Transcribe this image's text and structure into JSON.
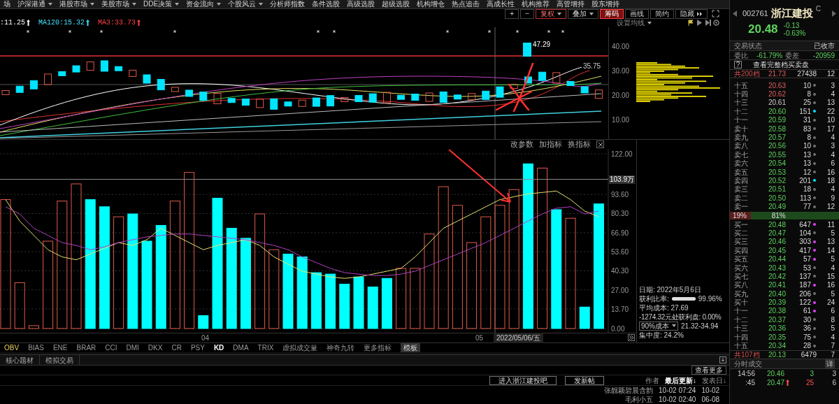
{
  "menu": [
    {
      "label": "场",
      "dropdown": false
    },
    {
      "label": "沪深港通",
      "dropdown": true
    },
    {
      "label": "港股市场",
      "dropdown": true
    },
    {
      "label": "美股市场",
      "dropdown": true
    },
    {
      "label": "DDE决策",
      "dropdown": true
    },
    {
      "label": "资金流向",
      "dropdown": true
    },
    {
      "label": "个股风云",
      "dropdown": true
    },
    {
      "label": "分析师指数",
      "dropdown": false
    },
    {
      "label": "条件选股",
      "dropdown": false
    },
    {
      "label": "高级选股",
      "dropdown": false
    },
    {
      "label": "超级选股",
      "dropdown": false
    },
    {
      "label": "机构增仓",
      "dropdown": false
    },
    {
      "label": "热点追击",
      "dropdown": false
    },
    {
      "label": "高成长性",
      "dropdown": false
    },
    {
      "label": "机构推荐",
      "dropdown": false
    },
    {
      "label": "高管增持",
      "dropdown": false
    },
    {
      "label": "股东增持",
      "dropdown": false
    }
  ],
  "toolbar": [
    {
      "label": "+",
      "kind": "icon",
      "selected": false
    },
    {
      "label": "−",
      "kind": "icon",
      "selected": false
    },
    {
      "label": "复权",
      "kind": "dropdown",
      "selected": false
    },
    {
      "label": "叠加",
      "kind": "dropdown",
      "selected": false
    },
    {
      "label": "筹码",
      "kind": "plain",
      "selected": true
    },
    {
      "label": "画线",
      "kind": "plain",
      "selected": false
    },
    {
      "label": "简约",
      "kind": "plain",
      "selected": false
    },
    {
      "label": "隐藏",
      "kind": "more",
      "selected": false
    }
  ],
  "legend": [
    {
      "label": ":11.25",
      "color": "#ffffff"
    },
    {
      "label": "MA120:15.32",
      "color": "#40e0ff"
    },
    {
      "label": "MA3:33.73",
      "color": "#ff4040"
    }
  ],
  "ma_settings": "设置均线",
  "price_chart": {
    "yticks": [
      "40.00",
      "30.00",
      "20.00",
      "10.00"
    ],
    "high_label": "47.29",
    "last_label": "35.75"
  },
  "volume_panel": {
    "actions": [
      "改参数",
      "加指标",
      "换指标"
    ],
    "cursor_value": "103.9万",
    "chart_data": {
      "type": "bar",
      "ylim": [
        0,
        122
      ],
      "grid": true,
      "yticks": [
        {
          "value": 0,
          "label": "0.00"
        },
        {
          "value": 13.7,
          "label": "13.70"
        },
        {
          "value": 27,
          "label": "27.00"
        },
        {
          "value": 40.3,
          "label": "40.30"
        },
        {
          "value": 53.6,
          "label": "53.60"
        },
        {
          "value": 66.9,
          "label": "66.90"
        },
        {
          "value": 80.3,
          "label": "80.30"
        },
        {
          "value": 93.6,
          "label": "93.60"
        },
        {
          "value": 122,
          "label": "122.00"
        }
      ],
      "series": [
        {
          "type": "bar",
          "color": "#e05a4a",
          "values": [
            90,
            32,
            2,
            61,
            89,
            101,
            null,
            null,
            78,
            null,
            null,
            null,
            89,
            109,
            null,
            null,
            null,
            null,
            80,
            55,
            null,
            null,
            null,
            null,
            null,
            null,
            null,
            null,
            42,
            42,
            66,
            99,
            86,
            60,
            78,
            86,
            97,
            null,
            112,
            null,
            77,
            null,
            null
          ]
        },
        {
          "type": "bar",
          "color": "#00ffff",
          "values": [
            null,
            null,
            null,
            null,
            null,
            null,
            90,
            85,
            null,
            80,
            61,
            72,
            null,
            null,
            9,
            91,
            70,
            63,
            null,
            null,
            52,
            50,
            39,
            38,
            31,
            36,
            29,
            35,
            null,
            null,
            null,
            null,
            null,
            null,
            null,
            null,
            null,
            115,
            null,
            83,
            null,
            15,
            87
          ]
        },
        {
          "type": "line",
          "color": "#e8e070",
          "values": [
            90,
            75,
            65,
            55,
            50,
            48,
            52,
            56,
            60,
            58,
            62,
            70,
            65,
            60,
            55,
            58,
            60,
            62,
            58,
            50,
            45,
            40,
            38,
            36,
            35,
            36,
            38,
            40,
            42,
            50,
            60,
            70,
            75,
            80,
            85,
            90,
            92,
            94,
            95,
            96,
            90,
            82,
            78
          ]
        },
        {
          "type": "line",
          "color": "#b040c0",
          "values": [
            85,
            80,
            70,
            65,
            60,
            58,
            55,
            57,
            60,
            62,
            64,
            65,
            66,
            66,
            65,
            64,
            63,
            62,
            60,
            58,
            55,
            50,
            46,
            42,
            39,
            38,
            37,
            37,
            38,
            40,
            44,
            48,
            52,
            56,
            60,
            65,
            70,
            75,
            80,
            84,
            85,
            80,
            82
          ]
        }
      ]
    }
  },
  "x_axis": {
    "labels": [
      "04",
      "05"
    ],
    "cursor_date": "2022/05/06/五"
  },
  "chips": {
    "date": "日期: 2022年5月6日",
    "profit_label": "获利比率:",
    "profit_bar": {
      "level": 0.9996
    },
    "profit_value": "99.96%",
    "avg_cost": "平均成本: 27.69",
    "profit_at": "-1274.32元处获利盘: 0.00%",
    "cost_select": "90%成本",
    "cost_range": "21.32-34.94",
    "concentration": "集中度: 24.2%"
  },
  "indicators": [
    {
      "label": "OBV",
      "selected": false,
      "highlight": true
    },
    {
      "label": "BIAS",
      "selected": false,
      "highlight": false
    },
    {
      "label": "ENE",
      "selected": false,
      "highlight": false
    },
    {
      "label": "BRAR",
      "selected": false,
      "highlight": false
    },
    {
      "label": "CCI",
      "selected": false,
      "highlight": false
    },
    {
      "label": "DMI",
      "selected": false,
      "highlight": false
    },
    {
      "label": "DKX",
      "selected": false,
      "highlight": false
    },
    {
      "label": "CR",
      "selected": false,
      "highlight": false
    },
    {
      "label": "PSY",
      "selected": false,
      "highlight": false
    },
    {
      "label": "KD",
      "selected": true,
      "highlight": false
    },
    {
      "label": "DMA",
      "selected": false,
      "highlight": false
    },
    {
      "label": "TRIX",
      "selected": false,
      "highlight": false
    },
    {
      "label": "虚拟成交量",
      "selected": false,
      "highlight": false
    },
    {
      "label": "神奇九转",
      "selected": false,
      "highlight": false
    },
    {
      "label": "更多指标",
      "selected": false,
      "highlight": false
    }
  ],
  "template_button": "模板",
  "bottom_tabs": [
    {
      "label": "核心题材",
      "selected": false
    },
    {
      "label": "模拟交易",
      "selected": false
    }
  ],
  "more_button": "查看更多",
  "forum": {
    "buttons": [
      "进入浙江建投吧",
      "发新帖"
    ],
    "columns": [
      {
        "label": "作者",
        "selected": false
      },
      {
        "label": "最后更新↓",
        "selected": true
      },
      {
        "label": "发表日↓",
        "selected": false
      }
    ],
    "rows": [
      [
        "张靓颖碧晨含韵",
        "10-02 07:24",
        "10-02"
      ],
      [
        "毛利小五",
        "10-02 02:40",
        "06-08"
      ]
    ]
  },
  "quote": {
    "code": "002761",
    "name": "浙江建投",
    "flag": "C",
    "price": "20.48",
    "change": "-0.13",
    "change_pct": "-0.63%",
    "status_label": "交易状态",
    "status": "已收市",
    "ratio_label": "委比",
    "ratio": "-61.79%",
    "diff_label": "委差",
    "diff": "-20959",
    "help": "?",
    "full_book": "查看完整档买卖盘"
  },
  "sell_total": {
    "label": "共200档",
    "price": "21.73",
    "volume": "27438",
    "count": "12"
  },
  "sells": [
    {
      "label": "十五",
      "price": "20.63",
      "volume": "10",
      "count": "3",
      "up": true,
      "down": false,
      "dot": {
        "color": "#707070"
      }
    },
    {
      "label": "十四",
      "price": "20.62",
      "volume": "8",
      "count": "4",
      "up": true,
      "down": false,
      "dot": {
        "color": "#707070"
      }
    },
    {
      "label": "十三",
      "price": "20.61",
      "volume": "25",
      "count": "13",
      "up": false,
      "down": false,
      "dot": {
        "color": "#707070"
      }
    },
    {
      "label": "十二",
      "price": "20.60",
      "volume": "151",
      "count": "22",
      "up": false,
      "down": true,
      "dot": {
        "color": "#00e5ff"
      }
    },
    {
      "label": "十一",
      "price": "20.59",
      "volume": "31",
      "count": "10",
      "up": false,
      "down": true,
      "dot": {
        "color": "#707070"
      }
    },
    {
      "label": "卖十",
      "price": "20.58",
      "volume": "83",
      "count": "17",
      "up": false,
      "down": true,
      "dot": {
        "color": "#707070"
      }
    },
    {
      "label": "卖九",
      "price": "20.57",
      "volume": "8",
      "count": "4",
      "up": false,
      "down": true,
      "dot": {
        "color": "#707070"
      }
    },
    {
      "label": "卖八",
      "price": "20.56",
      "volume": "10",
      "count": "3",
      "up": false,
      "down": true,
      "dot": {
        "color": "#707070"
      }
    },
    {
      "label": "卖七",
      "price": "20.55",
      "volume": "13",
      "count": "4",
      "up": false,
      "down": true,
      "dot": {
        "color": "#707070"
      }
    },
    {
      "label": "卖六",
      "price": "20.54",
      "volume": "13",
      "count": "6",
      "up": false,
      "down": true,
      "dot": {
        "color": "#707070"
      }
    },
    {
      "label": "卖五",
      "price": "20.53",
      "volume": "12",
      "count": "16",
      "up": false,
      "down": true,
      "dot": {
        "color": "#707070"
      }
    },
    {
      "label": "卖四",
      "price": "20.52",
      "volume": "201",
      "count": "18",
      "up": false,
      "down": true,
      "dot": {
        "color": "#00e5ff"
      }
    },
    {
      "label": "卖三",
      "price": "20.51",
      "volume": "18",
      "count": "4",
      "up": false,
      "down": true,
      "dot": {
        "color": "#707070"
      }
    },
    {
      "label": "卖二",
      "price": "20.50",
      "volume": "113",
      "count": "9",
      "up": false,
      "down": true,
      "dot": {
        "color": "#707070"
      }
    },
    {
      "label": "卖一",
      "price": "20.49",
      "volume": "77",
      "count": "12",
      "up": false,
      "down": true,
      "dot": {
        "color": "#707070"
      }
    }
  ],
  "balance": {
    "level": 0.19,
    "sell_pct": "19%",
    "buy_pct": "81%"
  },
  "buys": [
    {
      "label": "买一",
      "price": "20.48",
      "volume": "647",
      "count": "11",
      "dot": {
        "color": "#e040fb"
      }
    },
    {
      "label": "买二",
      "price": "20.47",
      "volume": "104",
      "count": "5",
      "dot": {
        "color": "#707070"
      }
    },
    {
      "label": "买三",
      "price": "20.46",
      "volume": "303",
      "count": "13",
      "dot": {
        "color": "#e040fb"
      }
    },
    {
      "label": "买四",
      "price": "20.45",
      "volume": "417",
      "count": "14",
      "dot": {
        "color": "#e040fb"
      }
    },
    {
      "label": "买五",
      "price": "20.44",
      "volume": "57",
      "count": "5",
      "dot": {
        "color": "#e040fb"
      }
    },
    {
      "label": "买六",
      "price": "20.43",
      "volume": "53",
      "count": "4",
      "dot": {
        "color": "#707070"
      }
    },
    {
      "label": "买七",
      "price": "20.42",
      "volume": "137",
      "count": "15",
      "dot": {
        "color": "#707070"
      }
    },
    {
      "label": "买八",
      "price": "20.41",
      "volume": "187",
      "count": "16",
      "dot": {
        "color": "#e040fb"
      }
    },
    {
      "label": "买九",
      "price": "20.40",
      "volume": "206",
      "count": "5",
      "dot": {
        "color": "#707070"
      }
    },
    {
      "label": "买十",
      "price": "20.39",
      "volume": "122",
      "count": "24",
      "dot": {
        "color": "#e040fb"
      }
    },
    {
      "label": "十一",
      "price": "20.38",
      "volume": "61",
      "count": "6",
      "dot": {
        "color": "#e040fb"
      }
    },
    {
      "label": "十二",
      "price": "20.37",
      "volume": "30",
      "count": "8",
      "dot": {
        "color": "#707070"
      }
    },
    {
      "label": "十三",
      "price": "20.36",
      "volume": "36",
      "count": "5",
      "dot": {
        "color": "#707070"
      }
    },
    {
      "label": "十四",
      "price": "20.35",
      "volume": "75",
      "count": "4",
      "dot": {
        "color": "#707070"
      }
    },
    {
      "label": "十五",
      "price": "20.34",
      "volume": "28",
      "count": "7",
      "dot": {
        "color": "#707070"
      }
    }
  ],
  "buy_total": {
    "label": "共107档",
    "price": "20.13",
    "volume": "6479",
    "count": "7"
  },
  "ticks_header": {
    "label": "分时成交",
    "button": "详"
  },
  "ticks": [
    {
      "time": "14:56",
      "price": "20.46",
      "up": false,
      "volume": "3",
      "count": "3",
      "buy": false
    },
    {
      "time": ":45",
      "price": "20.47",
      "up": true,
      "volume": "25",
      "count": "6",
      "buy": true
    }
  ]
}
